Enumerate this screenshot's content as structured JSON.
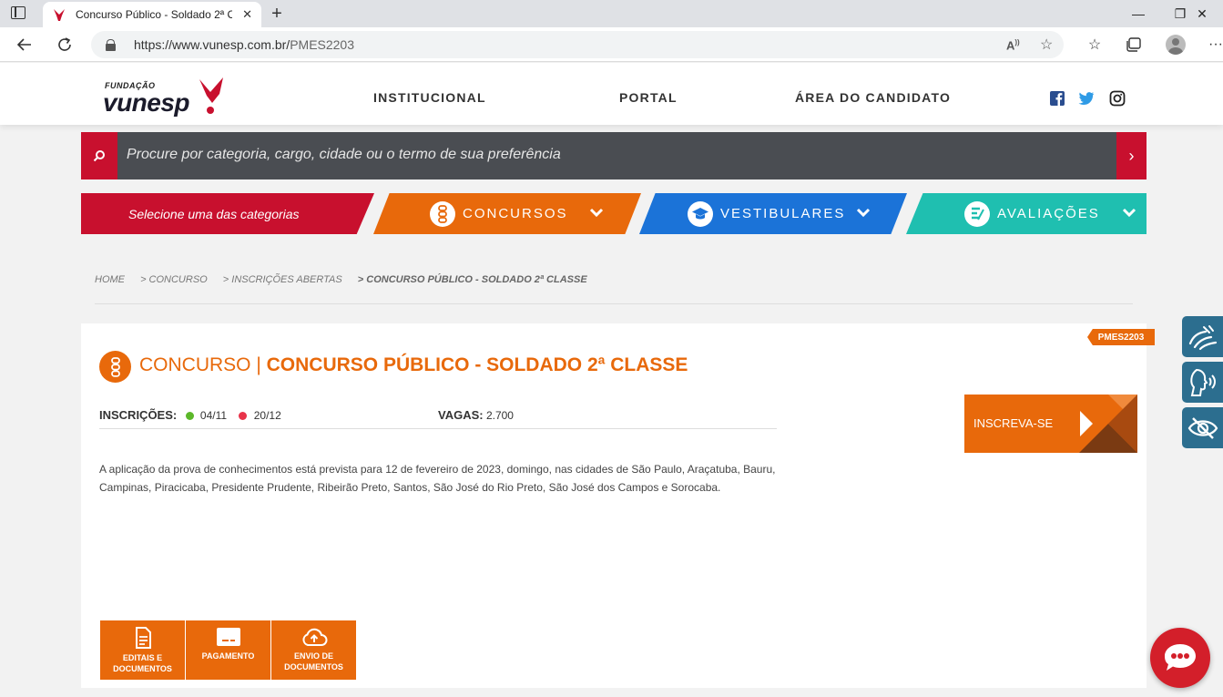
{
  "browser": {
    "tab_title": "Concurso Público - Soldado 2ª Classe",
    "url_host": "https://www.vunesp.com.br/",
    "url_path": "PMES2203",
    "win_minimize": "—",
    "win_restore": "❐",
    "win_close": "✕",
    "tab_close": "✕",
    "new_tab": "+",
    "more": "···"
  },
  "header": {
    "logo_small": "FUNDAÇÃO",
    "logo_brand": "vunesp",
    "nav": [
      "INSTITUCIONAL",
      "PORTAL",
      "ÁREA DO CANDIDATO"
    ]
  },
  "search": {
    "placeholder": "Procure por categoria, cargo, cidade ou o termo de sua preferência",
    "go": "›"
  },
  "categories": {
    "select_label": "Selecione uma das categorias",
    "concursos": "CONCURSOS",
    "vestibulares": "VESTIBULARES",
    "avaliacoes": "AVALIAÇÕES"
  },
  "breadcrumb": {
    "home": "HOME",
    "concurso": "> CONCURSO",
    "inscricoes": "> INSCRIÇÕES ABERTAS",
    "current": "> CONCURSO PÚBLICO - SOLDADO 2ª CLASSE"
  },
  "contest": {
    "code": "PMES2203",
    "type_label": "CONCURSO |",
    "title": "CONCURSO PÚBLICO - SOLDADO 2ª CLASSE",
    "inscricoes_label": "INSCRIÇÕES:",
    "start_date": "04/11",
    "end_date": "20/12",
    "vagas_label": "VAGAS:",
    "vagas_value": "2.700",
    "description": "A aplicação da prova de conhecimentos está prevista para 12 de fevereiro de 2023, domingo, nas cidades de São Paulo, Araçatuba, Bauru, Campinas, Piracicaba, Presidente Prudente, Ribeirão Preto, Santos, São José do Rio Preto, São José dos Campos e Sorocaba.",
    "subscribe": "INSCREVA-SE"
  },
  "actions": {
    "editais": "EDITAIS E DOCUMENTOS",
    "pagamento": "PAGAMENTO",
    "envio": "ENVIO DE DOCUMENTOS"
  },
  "colors": {
    "brand_red": "#c8102e",
    "orange": "#e8690b",
    "blue": "#1b73d8",
    "teal": "#1fbfb0",
    "green_dot": "#5cb82a",
    "red_dot": "#e8334a"
  }
}
